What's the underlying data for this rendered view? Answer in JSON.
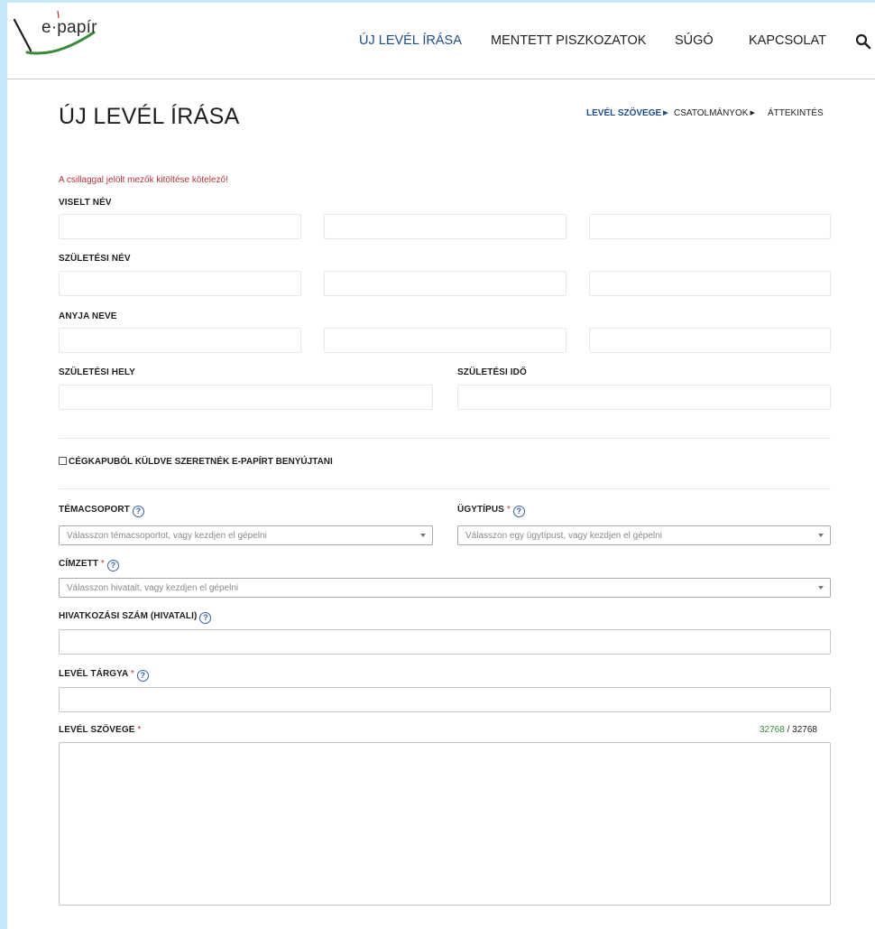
{
  "header": {
    "logo_text": "e·papír",
    "nav": [
      "ÚJ LEVÉL ÍRÁSA",
      "MENTETT PISZKOZATOK",
      "SÚGÓ",
      "KAPCSOLAT"
    ],
    "search_icon": "search-icon",
    "active_nav_color": "#1d4e8a"
  },
  "page": {
    "title": "ÚJ LEVÉL ÍRÁSA",
    "steps": [
      "LEVÉL SZÖVEGE",
      "CSATOLMÁNYOK",
      "ÁTTEKINTÉS"
    ],
    "active_step": "LEVÉL SZÖVEGE",
    "required_note": "A csillaggal jelölt mezők kitöltése kötelező!"
  },
  "form": {
    "viselt_nev_label": "VISELT NÉV",
    "szuletesi_nev_label": "SZÜLETÉSI NÉV",
    "anyja_neve_label": "ANYJA NEVE",
    "szuletesi_hely_label": "SZÜLETÉSI HELY",
    "szuletesi_ido_label": "SZÜLETÉSI IDŐ",
    "cegkapu_label": "CÉGKAPUBÓL KÜLDVE SZERETNÉK E-PAPÍRT BENYÚJTANI",
    "temacsoport_label": "TÉMACSOPORT",
    "temacsoport_placeholder": "Válasszon témacsoportot, vagy kezdjen el gépelni",
    "ugytipus_label": "ÜGYTÍPUS",
    "ugytipus_placeholder": "Válasszon egy ügytípust, vagy kezdjen el gépelni",
    "cimzett_label": "CÍMZETT",
    "cimzett_placeholder": "Válasszon hivatalt, vagy kezdjen el gépelni",
    "hivatkozasi_label": "HIVATKOZÁSI SZÁM (HIVATALI)",
    "targy_label": "LEVÉL TÁRGYA",
    "szoveg_label": "LEVÉL SZÖVEGE",
    "required_mark": "*",
    "help_glyph": "?",
    "counter_remaining": "32768",
    "counter_separator": " / ",
    "counter_max": "32768"
  },
  "colors": {
    "brand_blue": "#1d4e8a",
    "required_red": "#b2343a",
    "counter_green": "#3a8a3a",
    "accent_light_blue": "#c6e8fb"
  }
}
